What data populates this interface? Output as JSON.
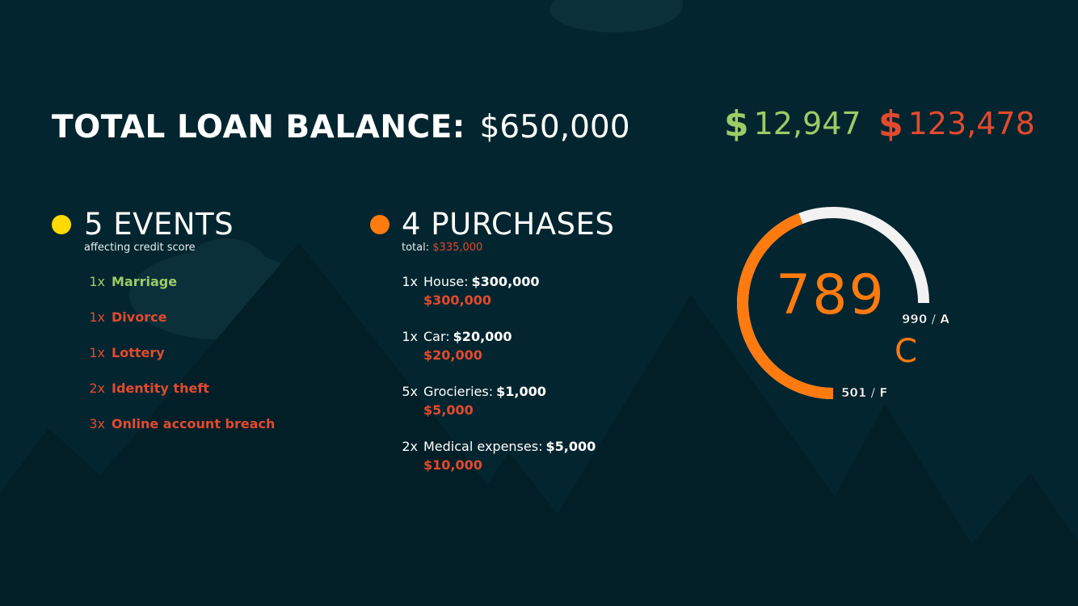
{
  "header": {
    "title_label": "TOTAL LOAN BALANCE:",
    "title_value": "$650,000"
  },
  "money": {
    "symbol": "$",
    "positive_value": "12,947",
    "negative_value": "123,478"
  },
  "events": {
    "heading": "5 EVENTS",
    "subtitle": "affecting credit score",
    "items": [
      {
        "qty": "1x",
        "name": "Marriage",
        "tone": "positive"
      },
      {
        "qty": "1x",
        "name": "Divorce",
        "tone": "negative"
      },
      {
        "qty": "1x",
        "name": "Lottery",
        "tone": "negative"
      },
      {
        "qty": "2x",
        "name": "Identity theft",
        "tone": "negative"
      },
      {
        "qty": "3x",
        "name": "Online account breach",
        "tone": "negative"
      }
    ]
  },
  "purchases": {
    "heading": "4 PURCHASES",
    "total_label": "total:",
    "total_value": "$335,000",
    "items": [
      {
        "qty": "1x",
        "label": "House:",
        "unit_price": "$300,000",
        "total": "$300,000"
      },
      {
        "qty": "1x",
        "label": "Car:",
        "unit_price": "$20,000",
        "total": "$20,000"
      },
      {
        "qty": "5x",
        "label": "Grocieries:",
        "unit_price": "$1,000",
        "total": "$5,000"
      },
      {
        "qty": "2x",
        "label": "Medical expenses:",
        "unit_price": "$5,000",
        "total": "$10,000"
      }
    ]
  },
  "credit_score": {
    "score": "789",
    "grade": "C",
    "max_label": "990 / A",
    "min_label": "501 / F",
    "score_min": 501,
    "score_max": 990,
    "score_value": 789
  },
  "colors": {
    "background": "#03252f",
    "positive": "#9bcc66",
    "negative": "#e24a2e",
    "events_dot": "#ffd900",
    "purchases_dot": "#ff7a0f",
    "gauge_fill": "#ff7a0f",
    "gauge_track": "#f2f2f2"
  }
}
